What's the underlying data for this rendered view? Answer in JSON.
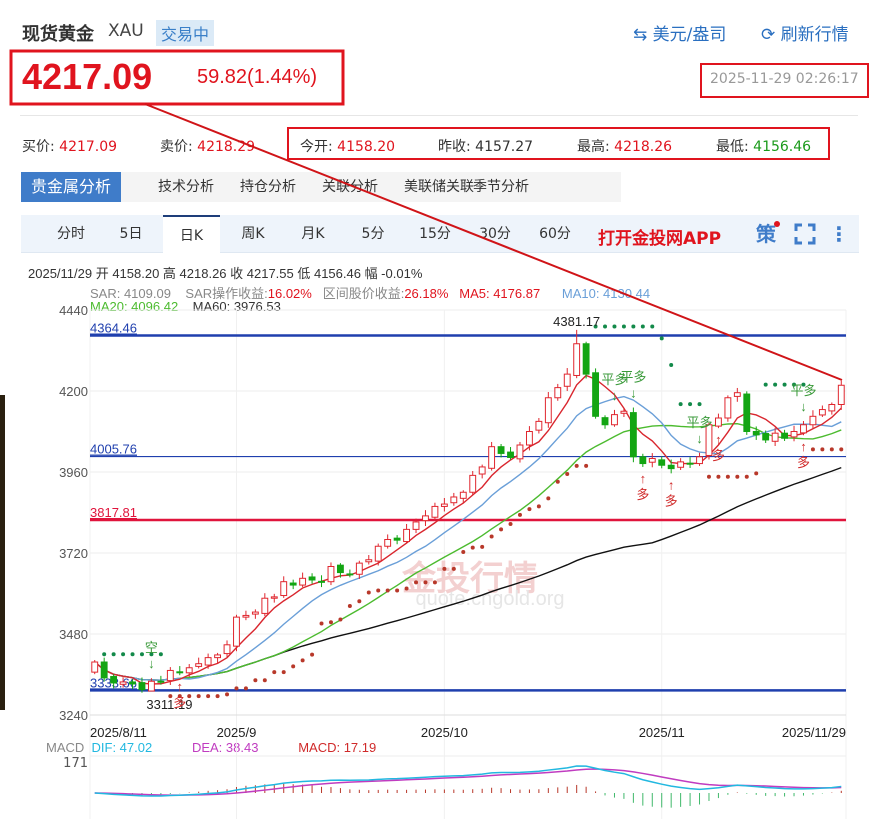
{
  "header": {
    "title": "现货黄金",
    "symbol": "XAU",
    "status": "交易中",
    "unit_link": "美元/盎司",
    "refresh_link": "刷新行情"
  },
  "quote": {
    "price": "4217.09",
    "change": "59.82(1.44%)",
    "timestamp": "2025-11-29 02:26:17",
    "bid_label": "买价:",
    "bid": "4217.09",
    "ask_label": "卖价:",
    "ask": "4218.29",
    "open_label": "今开:",
    "open": "4158.20",
    "prev_label": "昨收:",
    "prev": "4157.27",
    "high_label": "最高:",
    "high": "4218.26",
    "low_label": "最低:",
    "low": "4156.46"
  },
  "tabs": [
    "贵金属分析",
    "技术分析",
    "持仓分析",
    "关联分析",
    "美联储关联",
    "季节分析"
  ],
  "periods": [
    "分时",
    "5日",
    "日K",
    "周K",
    "月K",
    "5分",
    "15分",
    "30分",
    "60分"
  ],
  "active_period": "日K",
  "app_link": "打开金投网APP",
  "strategy_icon_label": "策",
  "info_line": "2025/11/29  开 4158.20  高 4218.26  收 4217.55  低 4156.46  幅 -0.01%",
  "indicators": {
    "sar": "SAR: 4109.09",
    "sar_ret_label": "SAR操作收益:",
    "sar_ret": "16.02%",
    "range_ret_label": "区间股价收益:",
    "range_ret": "26.18%",
    "ma5": "MA5: 4176.87",
    "ma10": "MA10: 4130.44",
    "ma20": "MA20: 4096.42",
    "ma60": "MA60: 3976.53"
  },
  "macd": {
    "label": "MACD",
    "dif": "DIF: 47.02",
    "dea": "DEA: 38.43",
    "macd": "MACD: 17.19",
    "top_tick": "171"
  },
  "watermark": "quote.cngold.org",
  "colors": {
    "up": "#e0262e",
    "down": "#13a513",
    "ma5": "#d9262e",
    "ma10": "#6a9fd8",
    "ma20": "#4cbb2f",
    "ma60": "#111111",
    "dif": "#22b8e0",
    "dea": "#c03cc0",
    "accent": "#3f7cc9"
  },
  "chart_data": {
    "type": "candlestick",
    "ylim": [
      3240,
      4440
    ],
    "yticks": [
      "4440",
      "4200",
      "3960",
      "3720",
      "3480",
      "3240"
    ],
    "xticks": [
      {
        "label": "2025/8/11",
        "index": 0
      },
      {
        "label": "2025/9",
        "index": 15
      },
      {
        "label": "2025/10",
        "index": 37
      },
      {
        "label": "2025/11",
        "index": 60
      },
      {
        "label": "2025/11/29",
        "index": 79
      }
    ],
    "closes": [
      3397,
      3350,
      3335,
      3338,
      3332,
      3315,
      3340,
      3338,
      3372,
      3365,
      3380,
      3392,
      3410,
      3418,
      3448,
      3530,
      3535,
      3545,
      3586,
      3590,
      3635,
      3625,
      3645,
      3640,
      3635,
      3680,
      3662,
      3657,
      3690,
      3700,
      3740,
      3760,
      3758,
      3790,
      3812,
      3830,
      3858,
      3865,
      3886,
      3900,
      3950,
      3975,
      4035,
      4015,
      4003,
      4040,
      4080,
      4110,
      4180,
      4210,
      4250,
      4340,
      4250,
      4125,
      4100,
      4130,
      4140,
      4005,
      3985,
      4000,
      3980,
      3970,
      3990,
      3985,
      4005,
      4100,
      4120,
      4180,
      4195,
      4080,
      4070,
      4055,
      4075,
      4060,
      4080,
      4100,
      4125,
      4145,
      4160,
      4217
    ],
    "hlines": [
      {
        "value": 4364.46,
        "label": "4364.46",
        "color": "#1f3fae"
      },
      {
        "value": 4005.76,
        "label": "4005.76",
        "color": "#1f3fae"
      },
      {
        "value": 3817.81,
        "label": "3817.81",
        "color": "#e0143c"
      },
      {
        "value": 3313,
        "label": "3333.66",
        "color": "#1f3fae"
      }
    ],
    "max_label": {
      "text": "4381.17",
      "index": 51,
      "value": 4381.17
    },
    "min_label": {
      "text": "3311.19",
      "index": 6,
      "value": 3311.19
    },
    "signals": [
      {
        "text": "空",
        "index": 6,
        "side": "above"
      },
      {
        "text": "多",
        "index": 9,
        "side": "below"
      },
      {
        "text": "平多",
        "index": 55,
        "side": "above"
      },
      {
        "text": "平多",
        "index": 57,
        "side": "above"
      },
      {
        "text": "多",
        "index": 58,
        "side": "below"
      },
      {
        "text": "多",
        "index": 61,
        "side": "below"
      },
      {
        "text": "平多",
        "index": 64,
        "side": "above"
      },
      {
        "text": "多",
        "index": 66,
        "side": "below"
      },
      {
        "text": "多",
        "index": 75,
        "side": "below"
      },
      {
        "text": "平多",
        "index": 75,
        "side": "above"
      }
    ]
  }
}
